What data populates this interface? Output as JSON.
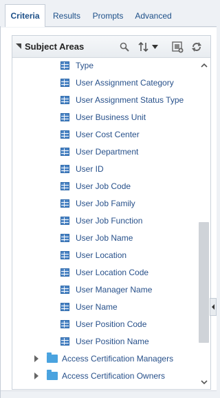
{
  "tabs": [
    "Criteria",
    "Results",
    "Prompts",
    "Advanced"
  ],
  "pane": {
    "title": "Subject Areas",
    "icons": [
      "search-icon",
      "sort-icon",
      "dropdown-arrow-icon",
      "add-filter-icon",
      "refresh-icon"
    ]
  },
  "columns": [
    "Type",
    "User Assignment Category",
    "User Assignment Status Type",
    "User Business Unit",
    "User Cost Center",
    "User Department",
    "User ID",
    "User Job Code",
    "User Job Family",
    "User Job Function",
    "User Job Name",
    "User Location",
    "User Location Code",
    "User Manager Name",
    "User Name",
    "User Position Code",
    "User Position Name"
  ],
  "folders": [
    "Access Certification Managers",
    "Access Certification Owners"
  ],
  "colors": {
    "link": "#27508a",
    "column_icon": "#4b84c4",
    "folder_icon": "#4aa3df"
  }
}
